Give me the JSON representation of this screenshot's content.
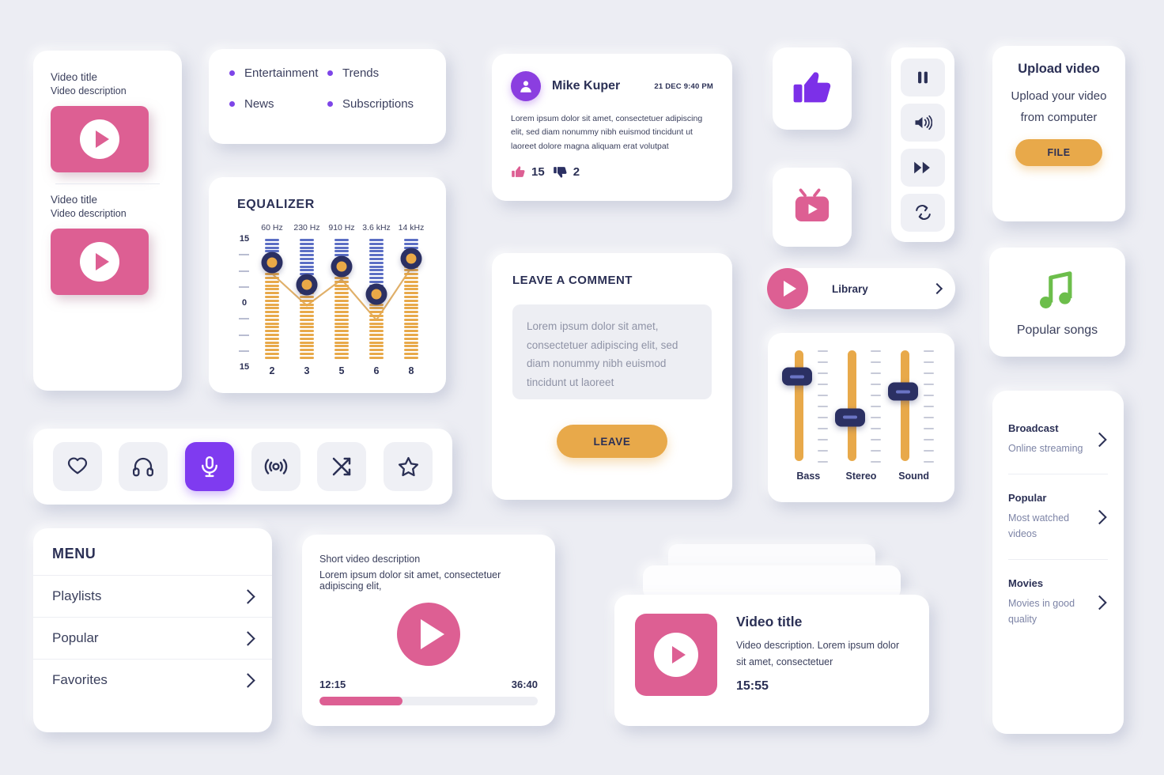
{
  "video_list": {
    "items": [
      {
        "title": "Video title",
        "description": "Video description",
        "thumb_icon": "play-icon"
      },
      {
        "title": "Video title",
        "description": "Video description",
        "thumb_icon": "play-icon"
      }
    ]
  },
  "categories": {
    "items": [
      {
        "label": "Entertainment"
      },
      {
        "label": "Trends"
      },
      {
        "label": "News"
      },
      {
        "label": "Subscriptions"
      }
    ],
    "bullet_color": "#7d45e8"
  },
  "equalizer": {
    "title": "EQUALIZER",
    "y_labels": {
      "top": "15",
      "middle": "0",
      "bottom": "15"
    }
  },
  "chart_data": {
    "type": "line",
    "title": "EQUALIZER",
    "categories": [
      "60 Hz",
      "230 Hz",
      "910 Hz",
      "3.6 kHz",
      "14 kHz"
    ],
    "x_tick_labels": [
      "2",
      "3",
      "5",
      "6",
      "8"
    ],
    "values": [
      9,
      3.5,
      8,
      1,
      10
    ],
    "ylim": [
      -15,
      15
    ],
    "ytick_labels": [
      "15",
      "0",
      "15"
    ],
    "ylabel": "",
    "xlabel": "",
    "grid": false,
    "legend": "none",
    "series_color": "#e0b06a",
    "marker_ring_color": "#2b3063",
    "marker_fill_color": "#eaa947",
    "above_track_color": "#5b6ec4",
    "below_track_color": "#e8a94a"
  },
  "toolbar": {
    "icons": [
      {
        "name": "heart-icon",
        "active": false
      },
      {
        "name": "headphones-icon",
        "active": false
      },
      {
        "name": "microphone-icon",
        "active": true
      },
      {
        "name": "broadcast-icon",
        "active": false
      },
      {
        "name": "shuffle-icon",
        "active": false
      },
      {
        "name": "star-icon",
        "active": false
      }
    ],
    "active_color": "#7f3bf0"
  },
  "menu": {
    "title": "MENU",
    "items": [
      {
        "label": "Playlists"
      },
      {
        "label": "Popular"
      },
      {
        "label": "Favorites"
      }
    ]
  },
  "player": {
    "heading": "Short video description",
    "subtext": "Lorem ipsum dolor sit amet, consectetuer adipiscing elit,",
    "current_time": "12:15",
    "total_time": "36:40",
    "progress_percent": 38
  },
  "comment": {
    "author": "Mike Kuper",
    "date": "21 DEC 9:40 PM",
    "body": "Lorem ipsum dolor sit amet, consectetuer adipiscing elit, sed diam nonummy nibh euismod tincidunt ut laoreet dolore magna aliquam erat volutpat",
    "likes": "15",
    "dislikes": "2"
  },
  "leave_comment": {
    "title": "LEAVE A COMMENT",
    "placeholder": "Lorem ipsum dolor sit amet, consectetuer adipiscing elit, sed diam nonummy nibh euismod tincidunt ut laoreet",
    "button_label": "LEAVE"
  },
  "stacked_video": {
    "title": "Video title",
    "description": "Video description. Lorem ipsum dolor sit amet, consectetuer",
    "duration": "15:55"
  },
  "tiles": {
    "like": {
      "icon": "thumbs-up-icon",
      "color": "#7c30e8"
    },
    "tv": {
      "icon": "tv-play-icon",
      "color": "#dd5f93"
    }
  },
  "transport": {
    "buttons": [
      {
        "name": "pause-icon"
      },
      {
        "name": "volume-icon"
      },
      {
        "name": "fast-forward-icon"
      },
      {
        "name": "repeat-icon"
      }
    ]
  },
  "library": {
    "label": "Library"
  },
  "mixer": {
    "sliders": [
      {
        "label": "Bass",
        "value_percent": 25
      },
      {
        "label": "Stereo",
        "value_percent": 60
      },
      {
        "label": "Sound",
        "value_percent": 38
      }
    ]
  },
  "upload": {
    "title": "Upload video",
    "text": "Upload your video from computer",
    "button_label": "FILE",
    "button_color": "#e8a94a"
  },
  "popular_songs": {
    "label": "Popular songs",
    "icon_color": "#6cbe4b"
  },
  "broadcast": {
    "items": [
      {
        "title": "Broadcast",
        "subtitle": "Online streaming"
      },
      {
        "title": "Popular",
        "subtitle": "Most watched videos"
      },
      {
        "title": "Movies",
        "subtitle": "Movies in good quality"
      }
    ]
  },
  "theme": {
    "background": "#ecedf3",
    "pink": "#dd5f93",
    "purple": "#7f3bf0",
    "orange": "#e8a94a",
    "navy": "#2b3055",
    "green": "#6cbe4b"
  }
}
